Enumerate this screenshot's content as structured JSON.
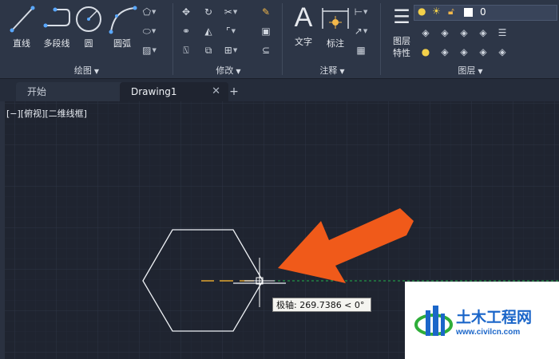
{
  "ribbon": {
    "draw": {
      "title": "绘图",
      "line_label": "直线",
      "polyline_label": "多段线",
      "circle_label": "圆",
      "arc_label": "圆弧"
    },
    "modify": {
      "title": "修改"
    },
    "annotation": {
      "title": "注释",
      "text_label": "文字",
      "dimension_label": "标注"
    },
    "layers": {
      "title": "图层",
      "properties_label_line1": "图层",
      "properties_label_line2": "特性",
      "current_layer": "0"
    }
  },
  "tabs": {
    "start_label": "开始",
    "drawing_label": "Drawing1",
    "close_glyph": "✕",
    "add_glyph": "+"
  },
  "viewport": {
    "label": "[−][俯视][二维线框]"
  },
  "tooltip": {
    "text": "极轴: 269.7386 < 0°"
  },
  "watermark": {
    "title": "土木工程网",
    "url": "www.civilcn.com"
  },
  "colors": {
    "background": "#1f2430",
    "ribbon": "#2d3647",
    "arrow": "#f05a1a",
    "polar_line": "#22b14c",
    "tracking": "#e1a531",
    "brand": "#1b66c9"
  }
}
